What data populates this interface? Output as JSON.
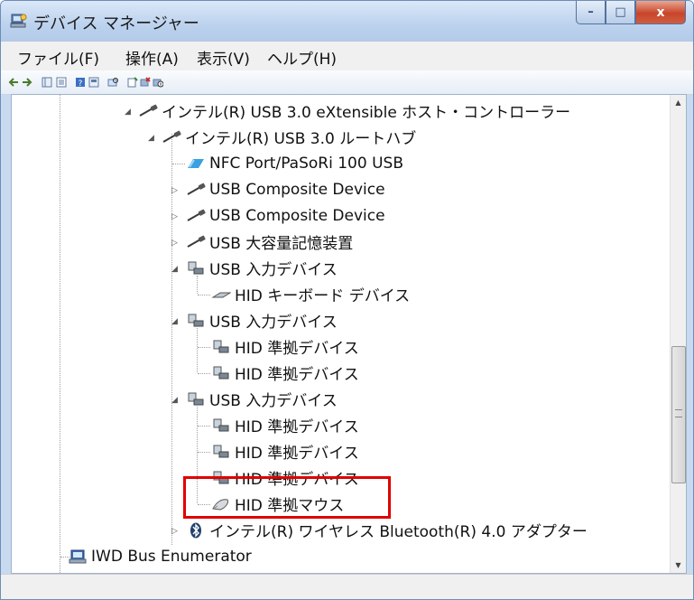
{
  "window": {
    "title": "デバイス マネージャー"
  },
  "caption": {
    "minimize": "–",
    "maximize": "□",
    "close": "x"
  },
  "menu": [
    "ファイル(F)",
    "操作(A)",
    "表示(V)",
    "ヘルプ(H)"
  ],
  "tree": [
    {
      "label": "インテル(R) USB 3.0 eXtensible ホスト・コントローラー",
      "icon": "usb-plug-icon",
      "expander": "expanded"
    },
    {
      "label": "インテル(R) USB 3.0 ルートハブ",
      "icon": "usb-plug-icon",
      "expander": "expanded"
    },
    {
      "label": "NFC Port/PaSoRi 100 USB",
      "icon": "nfc-reader-icon",
      "expander": "none"
    },
    {
      "label": "USB Composite Device",
      "icon": "usb-plug-icon",
      "expander": "collapsed"
    },
    {
      "label": "USB Composite Device",
      "icon": "usb-plug-icon",
      "expander": "collapsed"
    },
    {
      "label": "USB 大容量記憶装置",
      "icon": "usb-plug-icon",
      "expander": "collapsed"
    },
    {
      "label": "USB 入力デバイス",
      "icon": "hid-device-icon",
      "expander": "expanded"
    },
    {
      "label": "HID キーボード デバイス",
      "icon": "keyboard-icon",
      "expander": "none"
    },
    {
      "label": "USB 入力デバイス",
      "icon": "hid-device-icon",
      "expander": "expanded"
    },
    {
      "label": "HID 準拠デバイス",
      "icon": "hid-device-icon",
      "expander": "none"
    },
    {
      "label": "HID 準拠デバイス",
      "icon": "hid-device-icon",
      "expander": "none"
    },
    {
      "label": "USB 入力デバイス",
      "icon": "hid-device-icon",
      "expander": "expanded"
    },
    {
      "label": "HID 準拠デバイス",
      "icon": "hid-device-icon",
      "expander": "none"
    },
    {
      "label": "HID 準拠デバイス",
      "icon": "hid-device-icon",
      "expander": "none"
    },
    {
      "label": "HID 準拠デバイス",
      "icon": "hid-device-icon",
      "expander": "none"
    },
    {
      "label": "HID 準拠マウス",
      "icon": "mouse-icon",
      "expander": "none"
    },
    {
      "label": "インテル(R) ワイヤレス Bluetooth(R) 4.0 アダプター",
      "icon": "bluetooth-icon",
      "expander": "collapsed"
    },
    {
      "label": "IWD Bus Enumerator",
      "icon": "bus-enumerator-icon",
      "expander": "none"
    }
  ],
  "colors": {
    "highlight": "#e00000",
    "titlebar": "#bcd2ee"
  }
}
